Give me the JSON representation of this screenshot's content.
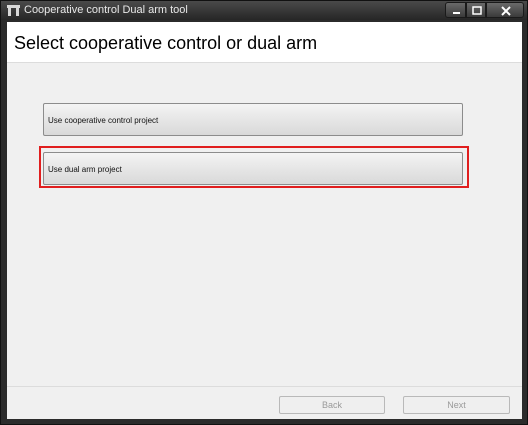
{
  "window": {
    "title": "Cooperative control Dual arm tool"
  },
  "header": {
    "title": "Select cooperative control or dual arm"
  },
  "options": {
    "cooperative_label": "Use cooperative control project",
    "dual_arm_label": "Use dual arm project"
  },
  "footer": {
    "back_label": "Back",
    "next_label": "Next"
  },
  "colors": {
    "highlight": "#e01e1e"
  }
}
